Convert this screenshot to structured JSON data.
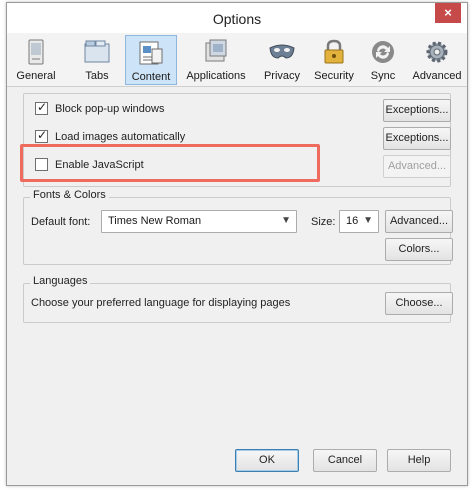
{
  "window": {
    "title": "Options",
    "close_icon": "close-icon",
    "close_glyph": "×"
  },
  "toolbar": {
    "items": [
      {
        "label": "General",
        "icon": "general-icon"
      },
      {
        "label": "Tabs",
        "icon": "tabs-icon"
      },
      {
        "label": "Content",
        "icon": "content-icon",
        "active": true
      },
      {
        "label": "Applications",
        "icon": "applications-icon"
      },
      {
        "label": "Privacy",
        "icon": "privacy-mask-icon"
      },
      {
        "label": "Security",
        "icon": "lock-icon"
      },
      {
        "label": "Sync",
        "icon": "sync-icon"
      },
      {
        "label": "Advanced",
        "icon": "gear-icon"
      }
    ]
  },
  "content": {
    "block_popups": {
      "label": "Block pop-up windows",
      "checked": true,
      "button": "Exceptions..."
    },
    "load_images": {
      "label": "Load images automatically",
      "checked": true,
      "button": "Exceptions..."
    },
    "javascript": {
      "label": "Enable JavaScript",
      "checked": false,
      "button": "Advanced..."
    },
    "fonts": {
      "title": "Fonts & Colors",
      "default_font_label": "Default font:",
      "default_font_value": "Times New Roman",
      "size_label": "Size:",
      "size_value": "16",
      "advanced_button": "Advanced...",
      "colors_button": "Colors..."
    },
    "languages": {
      "title": "Languages",
      "description": "Choose your preferred language for displaying pages",
      "choose_button": "Choose..."
    }
  },
  "footer": {
    "ok": "OK",
    "cancel": "Cancel",
    "help": "Help"
  },
  "colors": {
    "highlight": "#ef6b5e",
    "active_tab": "#cde3f7"
  }
}
